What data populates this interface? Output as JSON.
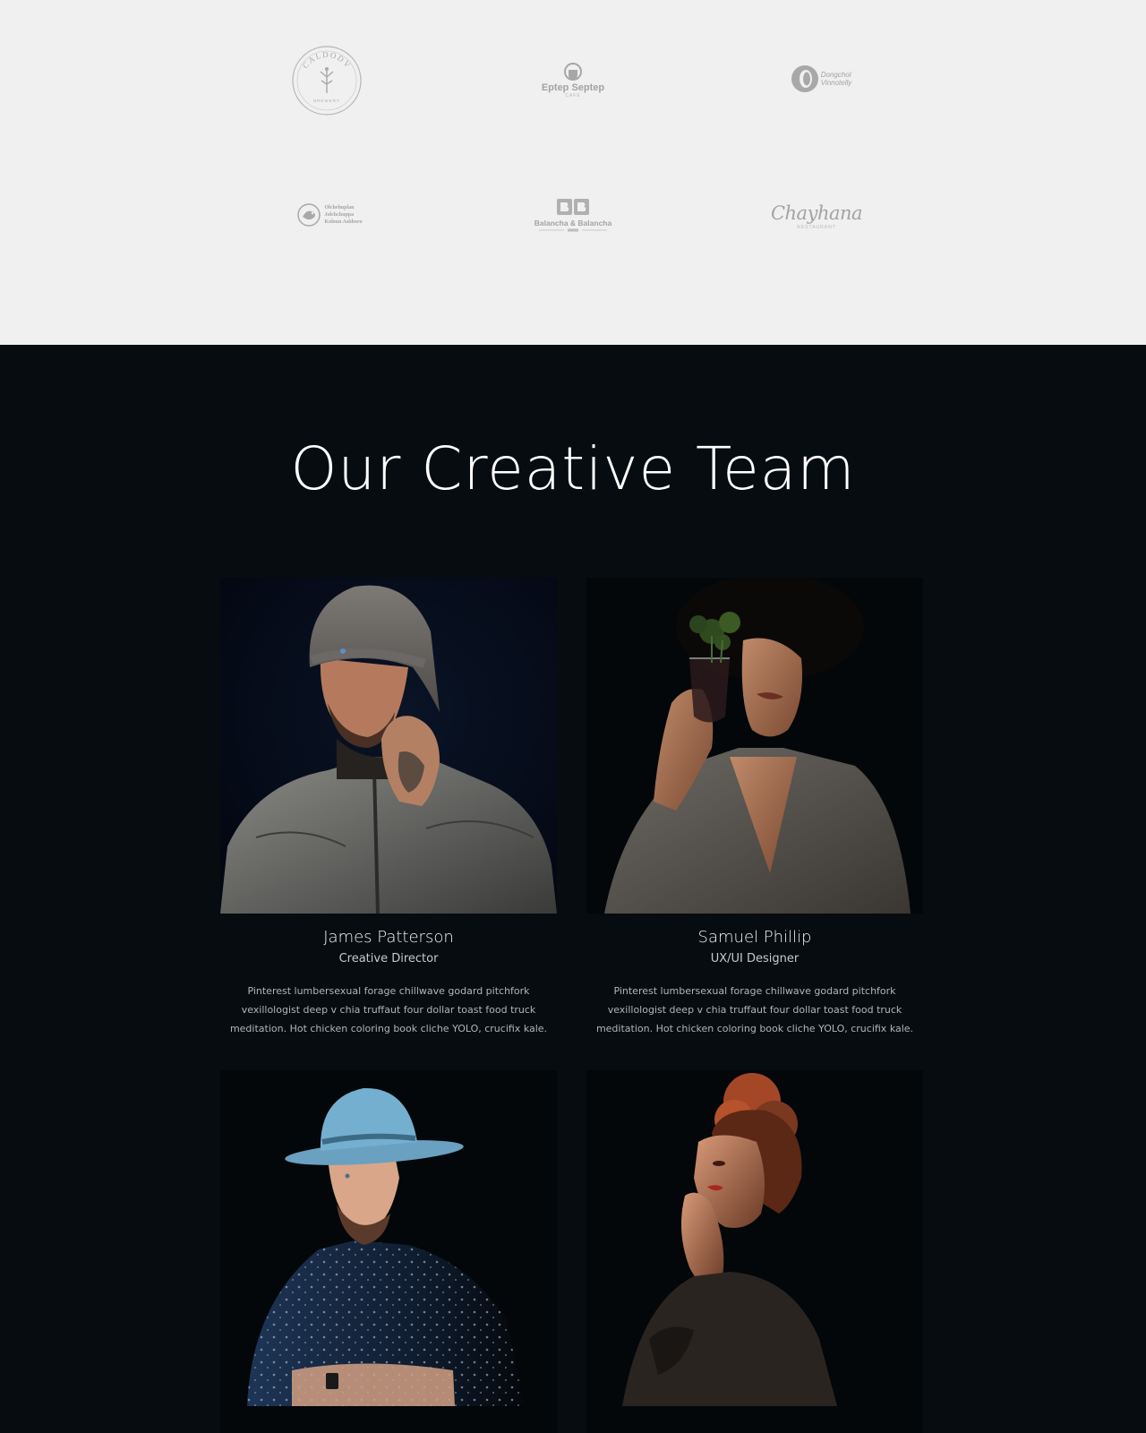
{
  "logos": [
    {
      "name": "Caldodv",
      "ring_text": "CALDODV",
      "sub": "BREWERY"
    },
    {
      "name": "Eptep Septep",
      "wordmark": "Eptep Septep",
      "sub": "CAFE"
    },
    {
      "name": "Dongchol Vinnotelly",
      "wordmark": "Dongchol\nVinnotelly"
    },
    {
      "name": "Olchehuplan",
      "wordmark": "Olchehuplan\nJolchchuppa\nKoloun Ashboro"
    },
    {
      "name": "Balancha & Balancha",
      "wordmark": "Balancha & Balancha"
    },
    {
      "name": "Chayhana",
      "wordmark": "Chayhana",
      "sub": "RESTAURANT"
    }
  ],
  "team": {
    "title": "Our Creative Team",
    "members": [
      {
        "name": "James Patterson",
        "role": "Creative Director",
        "bio": "Pinterest lumbersexual forage chillwave godard pitchfork vexillologist deep v chia truffaut four dollar toast food truck meditation. Hot chicken coloring book cliche YOLO, crucifix kale.",
        "photo": "man-in-knit-beanie-portrait"
      },
      {
        "name": "Samuel Phillip",
        "role": "UX/UI Designer",
        "bio": "Pinterest lumbersexual forage chillwave godard pitchfork vexillologist deep v chia truffaut four dollar toast food truck meditation. Hot chicken coloring book cliche YOLO, crucifix kale.",
        "photo": "man-holding-glass-with-plant-portrait"
      },
      {
        "photo": "man-in-blue-hat-portrait"
      },
      {
        "photo": "woman-with-red-hair-portrait"
      }
    ]
  },
  "colors": {
    "logos_bg": "#f0f0f0",
    "team_bg": "#060c10",
    "title": "#ffffff",
    "name": "#f2f2f2",
    "text": "#b4b4b4"
  }
}
